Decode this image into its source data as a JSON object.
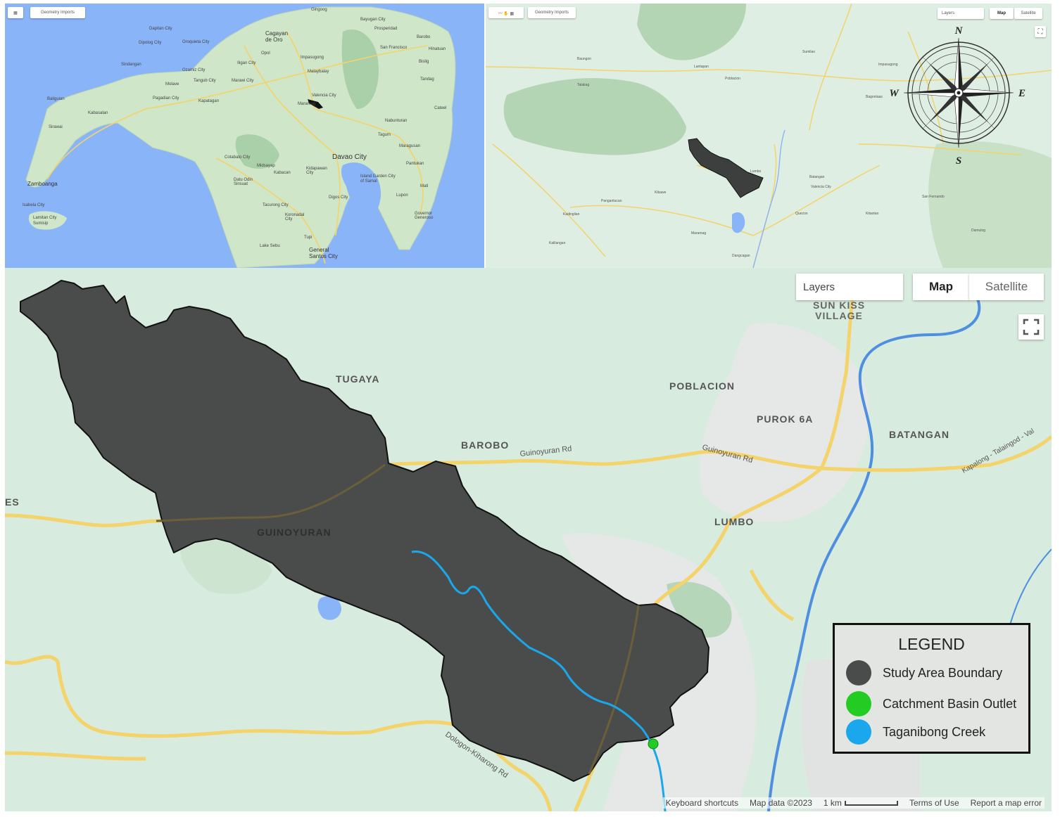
{
  "top_left_map": {
    "toolbar_label": "Geometry Imports",
    "places": [
      "Dapitan City",
      "Gingoog",
      "Cagayan de Oro",
      "Dipolog City",
      "Oroquieta City",
      "Sindangan",
      "Ozamiz City",
      "Tangub City",
      "Marawi City",
      "Molave",
      "Pagadian City",
      "Kapatagan",
      "Baliguian",
      "Malaybalay",
      "Valencia City",
      "Maramag",
      "Kabasalan",
      "Sirawai",
      "Zamboanga",
      "Isabela City",
      "Lamitan City",
      "Sumisip",
      "Cotabato City",
      "Midsayap",
      "Kabacan",
      "Datu Odin Sinsuat",
      "Kidapawan City",
      "Davao City",
      "Island Garden City of Samal",
      "Tacurong City",
      "Koronadal City",
      "Digos City",
      "Tupi",
      "Lake Sebu",
      "General Santos City",
      "Tagum",
      "Mati",
      "Bayugan City",
      "Prosperidad",
      "San Francisco",
      "Bislig",
      "Nabunturan",
      "Maragusan",
      "Pantukan",
      "Lupon",
      "Governor Generoso",
      "Tandag",
      "Cateel",
      "Impasugong",
      "Iligan City",
      "Opol",
      "Hinatuan",
      "Barobo"
    ]
  },
  "top_right_map": {
    "toolbar_label": "Geometry Imports",
    "layers_label": "Layers",
    "map_label": "Map",
    "satellite_label": "Satellite",
    "compass": {
      "n": "N",
      "s": "S",
      "e": "E",
      "w": "W"
    },
    "places": [
      "Lantapan",
      "Talakag",
      "Poblacion",
      "Sumilao",
      "Pangantucan",
      "Valencia City",
      "San Fernando",
      "Maramag",
      "Kalilangan",
      "Impasugong",
      "Baungon",
      "Kadingilan",
      "Quezon",
      "Kitaotao",
      "Damulog",
      "Lumbo",
      "Bagontaas",
      "Batangan",
      "Kibawe",
      "Dangcagan"
    ]
  },
  "main_map": {
    "layers_label": "Layers",
    "map_label": "Map",
    "satellite_label": "Satellite",
    "places": {
      "sun_kiss_village": "SUN KISS\nVILLAGE",
      "tugaya": "TUGAYA",
      "poblacion": "POBLACION",
      "purok_6a": "PUROK 6A",
      "barobo": "BAROBO",
      "batangan": "BATANGAN",
      "guinoyuran": "GUINOYURAN",
      "lumbo": "LUMBO",
      "es_partial": "ES"
    },
    "roads": {
      "guinoyuran_rd_1": "Guinoyuran Rd",
      "guinoyuran_rd_2": "Guinoyuran Rd",
      "kapalong_rd": "Kapalong - Talaingod - Val",
      "dologon_rd": "Dologon-Kiharong Rd"
    },
    "footer": {
      "shortcuts": "Keyboard shortcuts",
      "map_data": "Map data ©2023",
      "scale": "1 km",
      "terms": "Terms of Use",
      "report": "Report a map error"
    }
  },
  "legend": {
    "title": "LEGEND",
    "items": [
      {
        "label": "Study Area Boundary",
        "color": "#4a4c4b"
      },
      {
        "label": "Catchment Basin Outlet",
        "color": "#22cc22"
      },
      {
        "label": "Taganibong Creek",
        "color": "#1aa7ec"
      }
    ]
  },
  "colors": {
    "water": "#8ab4f8",
    "land": "#d8ebdf",
    "forest": "#b5d6b8",
    "road": "#f3d36a",
    "study_area": "#4a4c4b",
    "creek": "#1aa7ec",
    "outlet": "#22cc22",
    "river": "#4e8fe0"
  }
}
